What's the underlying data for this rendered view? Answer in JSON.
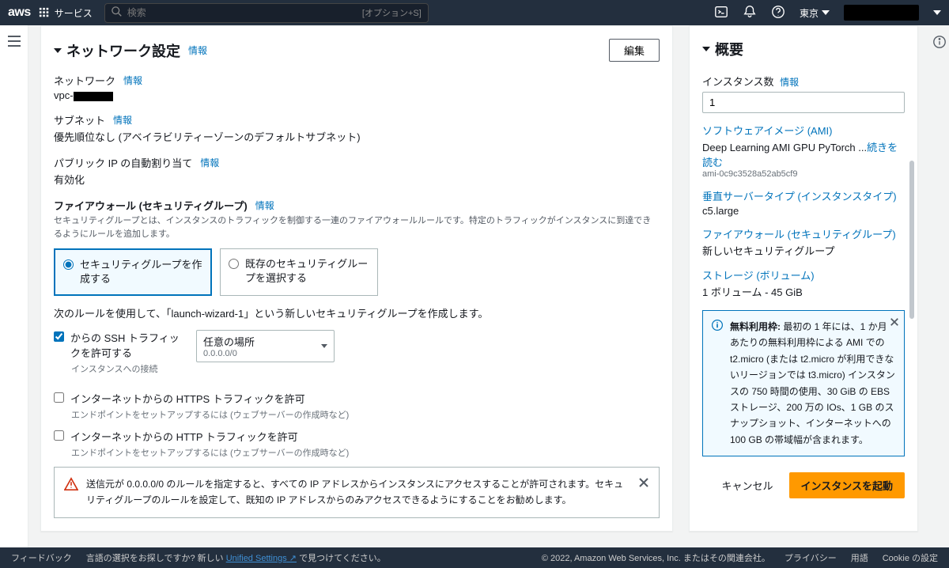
{
  "nav": {
    "services": "サービス",
    "search_placeholder": "検索",
    "search_shortcut": "[オプション+S]",
    "region": "東京"
  },
  "network_panel": {
    "title": "ネットワーク設定",
    "info": "情報",
    "edit": "編集",
    "network_label": "ネットワーク",
    "vpc_prefix": "vpc-",
    "subnet_label": "サブネット",
    "subnet_value": "優先順位なし (アベイラビリティーゾーンのデフォルトサブネット)",
    "public_ip_label": "パブリック IP の自動割り当て",
    "public_ip_value": "有効化",
    "firewall_label": "ファイアウォール (セキュリティグループ)",
    "firewall_desc": "セキュリティグループとは、インスタンスのトラフィックを制御する一連のファイアウォールルールです。特定のトラフィックがインスタンスに到達できるようにルールを追加します。",
    "radio_create": "セキュリティグループを作成する",
    "radio_existing": "既存のセキュリティグループを選択する",
    "sg_text": "次のルールを使用して、「launch-wizard-1」という新しいセキュリティグループを作成します。",
    "ssh_label": "からの SSH トラフィックを許可する",
    "ssh_hint": "インスタンスへの接続",
    "ssh_source": "任意の場所",
    "ssh_cidr": "0.0.0.0/0",
    "https_label": "インターネットからの HTTPS トラフィックを許可",
    "https_hint": "エンドポイントをセットアップするには (ウェブサーバーの作成時など)",
    "http_label": "インターネットからの HTTP トラフィックを許可",
    "http_hint": "エンドポイントをセットアップするには (ウェブサーバーの作成時など)",
    "alert_text": "送信元が 0.0.0.0/0 のルールを指定すると、すべての IP アドレスからインスタンスにアクセスすることが許可されます。セキュリティグループのルールを設定して、既知の IP アドレスからのみアクセスできるようにすることをお勧めします。"
  },
  "summary_panel": {
    "title": "概要",
    "instance_count_label": "インスタンス数",
    "info": "情報",
    "instance_count_value": "1",
    "software_image_label": "ソフトウェアイメージ (AMI)",
    "software_image_value": "Deep Learning AMI GPU PyTorch ...",
    "read_more": "続きを読む",
    "ami_id": "ami-0c9c3528a52ab5cf9",
    "instance_type_label": "垂直サーバータイプ (インスタンスタイプ)",
    "instance_type_value": "c5.large",
    "firewall_label": "ファイアウォール (セキュリティグループ)",
    "firewall_value": "新しいセキュリティグループ",
    "storage_label": "ストレージ (ボリューム)",
    "storage_value": "1 ボリューム - 45 GiB",
    "free_tier_label": "無料利用枠:",
    "free_tier_text": " 最初の 1 年には、1 か月あたりの無料利用枠による AMI での t2.micro (または t2.micro が利用できないリージョンでは t3.micro) インスタンスの 750 時間の使用、30 GiB の EBS ストレージ、200 万の IOs、1 GB のスナップショット、インターネットへの 100 GB の帯域幅が含まれます。",
    "cancel": "キャンセル",
    "launch": "インスタンスを起動"
  },
  "footer": {
    "feedback": "フィードバック",
    "lang_hint": "言語の選択をお探しですか? 新しい ",
    "unified": "Unified Settings",
    "lang_hint2": " で見つけてください。",
    "copyright": "© 2022, Amazon Web Services, Inc. またはその関連会社。",
    "privacy": "プライバシー",
    "terms": "用語",
    "cookie": "Cookie の設定"
  }
}
